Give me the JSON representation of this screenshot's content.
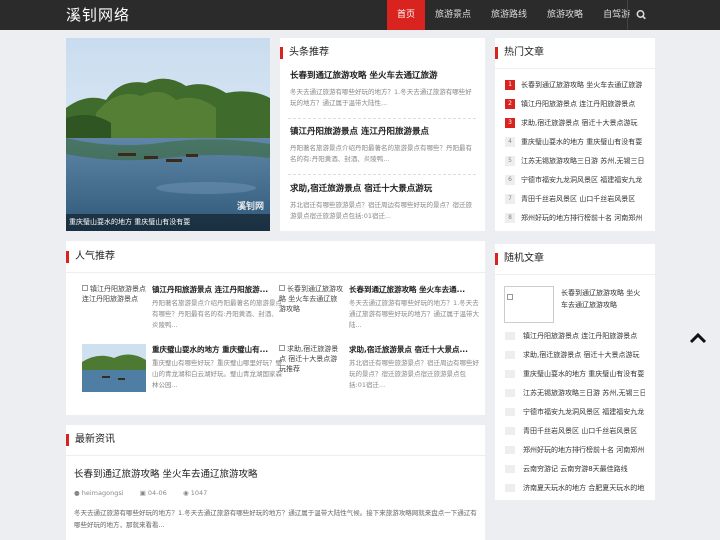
{
  "header": {
    "logo": "溪钊网络",
    "nav": [
      "首页",
      "旅游景点",
      "旅游路线",
      "旅游攻略",
      "自驾游"
    ],
    "search_icon": "search-icon"
  },
  "hero": {
    "caption": "重庆璧山耍水的地方 重庆璧山有没有耍",
    "stamp": "溪钊网"
  },
  "headlines": {
    "title": "头条推荐",
    "items": [
      {
        "title": "长春到通辽旅游攻略 坐火车去通辽旅游",
        "desc": "冬天去通辽旅游有哪些好玩的地方？1.冬天去通辽旅游有哪些好玩的地方？通辽属于温带大陆性..."
      },
      {
        "title": "镇江丹阳旅游景点 连江丹阳旅游景点",
        "desc": "丹阳著名旅游景点介绍丹阳最著名的旅游景点有哪些？丹阳最有名的有:丹阳黄酒、封酒、炎陵鸭..."
      },
      {
        "title": "求助,宿迁旅游景点 宿迁十大景点游玩",
        "desc": "苏北宿迁有哪些旅游景点？宿迁周边有哪些好玩的景点？宿迁旅游景点宿迁旅游景点包括:01宿迁..."
      }
    ]
  },
  "hot": {
    "title": "热门文章",
    "items": [
      "长春到通辽旅游攻略 坐火车去通辽旅游",
      "镇江丹阳旅游景点 连江丹阳旅游景点",
      "求助,宿迁旅游景点 宿迁十大景点游玩",
      "重庆璧山耍水的地方 重庆璧山有没有耍",
      "江苏无锡旅游攻略三日游 苏州,无锡三日",
      "宁德市福安九龙洞风景区 福建福安九龙",
      "青田千丝岩风景区 山口千丝岩风景区",
      "郑州好玩的地方排行榜前十名 河南郑州"
    ]
  },
  "popular": {
    "title": "人气推荐",
    "items": [
      {
        "alt": "镇江丹阳旅游景点 连江丹阳旅游景点",
        "title": "镇江丹阳旅游景点 连江丹阳旅游...",
        "desc": "丹阳著名旅游景点介绍丹阳最著名的旅游景点有哪些？丹阳最有名的有:丹阳黄酒、封酒、炎陵鸭..."
      },
      {
        "alt": "长春到通辽旅游攻略 坐火车去通辽旅游攻略",
        "title": "长春到通辽旅游攻略 坐火车去通...",
        "desc": "冬天去通辽旅游有哪些好玩的地方？1.冬天去通辽旅游有哪些好玩的地方？通辽属于温带大陆..."
      },
      {
        "alt": "",
        "title": "重庆璧山耍水的地方 重庆璧山有...",
        "desc": "重庆璧山有哪些好玩？重庆璧山哪里好玩？璧山的青龙湖和白云湖好玩。璧山青龙湖国家森林公园..."
      },
      {
        "alt": "求助,宿迁旅游景点 宿迁十大景点游玩推荐",
        "title": "求助,宿迁旅游景点 宿迁十大景点...",
        "desc": "苏北宿迁有哪些旅游景点？宿迁周边有哪些好玩的景点？宿迁旅游景点宿迁旅游景点包括:01宿迁..."
      }
    ]
  },
  "latest": {
    "title": "最新资讯",
    "article": {
      "title": "长春到通辽旅游攻略 坐火车去通辽旅游攻略",
      "author": "heimagongsi",
      "date": "04-06",
      "views": "1047",
      "desc": "冬天去通辽旅游有哪些好玩的地方？1.冬天去通辽旅游有哪些好玩的地方？通辽属于温带大陆性气候。接下来旅游攻略网就来盘点一下通辽有哪些好玩的地方，那就来看看..."
    }
  },
  "random": {
    "title": "随机文章",
    "featured": "长春到通辽旅游攻略 坐火车去通辽旅游攻略",
    "items": [
      "镇江丹阳旅游景点 连江丹阳旅游景点",
      "求助,宿迁旅游景点 宿迁十大景点游玩",
      "重庆璧山耍水的地方 重庆璧山有没有耍",
      "江苏无锡旅游攻略三日游 苏州,无锡三日",
      "宁德市福安九龙洞风景区 福建福安九龙",
      "青田千丝岩风景区 山口千丝岩风景区",
      "郑州好玩的地方排行榜前十名 河南郑州",
      "云南穷游记 云南穷游8天最佳路线",
      "济南夏天玩水的地方 合肥夏天玩水的地方"
    ]
  },
  "colors": {
    "accent": "#d8231f",
    "header": "#2b2b2b",
    "background": "#eceef1"
  }
}
